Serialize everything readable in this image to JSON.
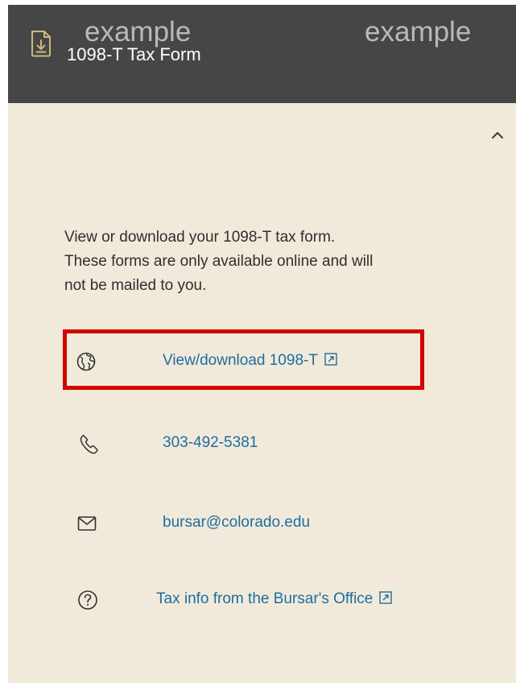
{
  "header": {
    "title": "1098-T Tax Form",
    "icon": "document-download-icon"
  },
  "watermarks": [
    "example",
    "example"
  ],
  "description": {
    "lines": [
      "View or download your 1098-T tax form.",
      "These forms are only available online and will",
      "not be mailed to you."
    ]
  },
  "links": {
    "view_download": {
      "label": "View/download 1098-T",
      "icon": "globe-icon"
    },
    "phone": {
      "label": "303-492-5381",
      "icon": "phone-icon"
    },
    "email": {
      "label": "bursar@colorado.edu",
      "icon": "envelope-icon"
    },
    "tax_info": {
      "label": "Tax info from the Bursar's Office",
      "icon": "question-circle-icon"
    }
  },
  "colors": {
    "header_bg": "#464646",
    "card_bg": "#f1eadb",
    "link": "#1d6ea0",
    "accent_gold": "#cfb87c",
    "highlight": "#d40000"
  }
}
